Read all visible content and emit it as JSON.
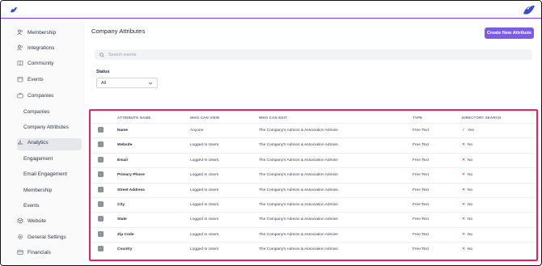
{
  "brand": {
    "logo_icon": "flock-logo-icon",
    "accent": "#7c5ce6",
    "highlight": "#e0245e"
  },
  "sidebar": {
    "items": [
      {
        "label": "Membership",
        "icon": "users-icon"
      },
      {
        "label": "Integrations",
        "icon": "users-icon"
      },
      {
        "label": "Community",
        "icon": "book-icon"
      },
      {
        "label": "Events",
        "icon": "calendar-icon"
      },
      {
        "label": "Companies",
        "icon": "briefcase-icon"
      },
      {
        "label": "Analytics",
        "icon": "bar-chart-icon"
      },
      {
        "label": "Website",
        "icon": "globe-icon"
      },
      {
        "label": "General Settings",
        "icon": "gear-icon"
      },
      {
        "label": "Financials",
        "icon": "card-icon"
      }
    ],
    "companies_sub": [
      "Companies",
      "Company Attributes"
    ],
    "analytics_sub": [
      "Engagement",
      "Email Engagement",
      "Membership",
      "Events"
    ],
    "active": "Company Attributes"
  },
  "main": {
    "title": "Company Attributes",
    "create_button": "Create New Attribute",
    "search_placeholder": "Search events",
    "status_label": "Status",
    "status_value": "All"
  },
  "table": {
    "columns": [
      "ATTRIBUTE NAME",
      "WHO CAN VIEW",
      "WHO CAN EDIT",
      "TYPE",
      "DIRECTORY SEARCH"
    ],
    "rows": [
      {
        "name": "Name",
        "view": "Anyone",
        "edit": "The Company's Admins & Association Admins",
        "type": "Free Text",
        "search": "Yes",
        "search_mark": "✓"
      },
      {
        "name": "Website",
        "view": "Logged In Users",
        "edit": "The Company's Admins & Association Admins",
        "type": "Free Text",
        "search": "No",
        "search_mark": "✕"
      },
      {
        "name": "Email",
        "view": "Logged In Users",
        "edit": "The Company's Admins & Association Admins",
        "type": "Free Text",
        "search": "No",
        "search_mark": "✕"
      },
      {
        "name": "Primary Phone",
        "view": "Logged In Users",
        "edit": "The Company's Admins & Association Admins",
        "type": "Free Text",
        "search": "No",
        "search_mark": "✕"
      },
      {
        "name": "Street Address",
        "view": "Logged In Users",
        "edit": "The Company's Admins & Association Admins",
        "type": "Free Text",
        "search": "No",
        "search_mark": "✕"
      },
      {
        "name": "City",
        "view": "Logged In Users",
        "edit": "The Company's Admins & Association Admins",
        "type": "Free Text",
        "search": "No",
        "search_mark": "✕"
      },
      {
        "name": "State",
        "view": "Logged In Users",
        "edit": "The Company's Admins & Association Admins",
        "type": "Free Text",
        "search": "No",
        "search_mark": "✕"
      },
      {
        "name": "Zip Code",
        "view": "Logged In Users",
        "edit": "The Company's Admins & Association Admins",
        "type": "Free Text",
        "search": "No",
        "search_mark": "✕"
      },
      {
        "name": "Country",
        "view": "Logged In Users",
        "edit": "The Company's Admins & Association Admins",
        "type": "Free Text",
        "search": "No",
        "search_mark": "✕"
      }
    ]
  }
}
